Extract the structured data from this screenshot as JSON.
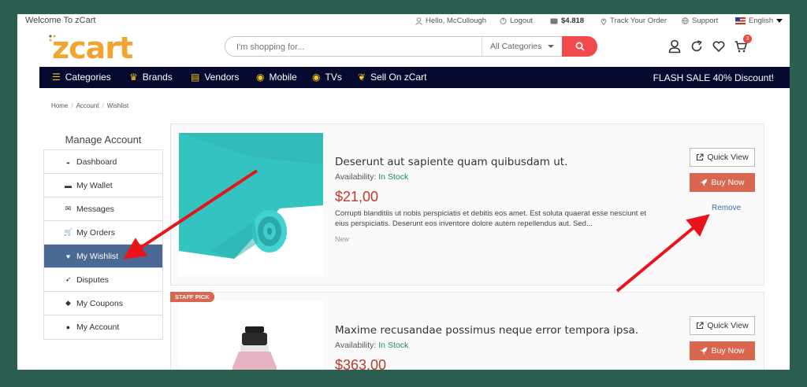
{
  "topbar": {
    "welcome": "Welcome To zCart",
    "greeting": "Hello, McCullough",
    "logout": "Logout",
    "wallet": "$4.818",
    "track": "Track Your Order",
    "support": "Support",
    "language": "English"
  },
  "header": {
    "logo": "zcart",
    "search_placeholder": "I'm shopping for...",
    "category_selected": "All Categories",
    "cart_count": "3"
  },
  "nav": {
    "items": [
      {
        "label": "Categories",
        "icon": "hamburger-icon"
      },
      {
        "label": "Brands",
        "icon": "crown-icon"
      },
      {
        "label": "Vendors",
        "icon": "store-icon"
      },
      {
        "label": "Mobile",
        "icon": "mobile-icon"
      },
      {
        "label": "TVs",
        "icon": "tv-icon"
      },
      {
        "label": "Sell On zCart",
        "icon": "seedling-icon"
      }
    ],
    "flash": "FLASH SALE 40% Discount!"
  },
  "breadcrumb": [
    "Home",
    "Account",
    "Wishlist"
  ],
  "sidebar": {
    "title": "Manage Account",
    "items": [
      {
        "label": "Dashboard",
        "icon": "gauge-icon"
      },
      {
        "label": "My Wallet",
        "icon": "wallet-icon"
      },
      {
        "label": "Messages",
        "icon": "envelope-icon"
      },
      {
        "label": "My Orders",
        "icon": "cart-icon"
      },
      {
        "label": "My Wishlist",
        "icon": "heart-icon"
      },
      {
        "label": "Disputes",
        "icon": "rocket-icon"
      },
      {
        "label": "My Coupons",
        "icon": "tags-icon"
      },
      {
        "label": "My Account",
        "icon": "user-icon"
      }
    ],
    "active": "My Wishlist"
  },
  "products": [
    {
      "title": "Deserunt aut sapiente quam quibusdam ut.",
      "availability_label": "Availability:",
      "availability": "In Stock",
      "price": "$21,00",
      "description": "Corrupti blanditiis ut nobis perspiciatis et debitis eos amet. Est soluta quaerat esse nesciunt et eius perspiciatis. Deserunt eos inventore dolore autem repellendus aut. Sed...",
      "condition": "New",
      "quick_view": "Quick View",
      "buy_now": "Buy Now",
      "remove": "Remove"
    },
    {
      "title": "Maxime recusandae possimus neque error tempora ipsa.",
      "availability_label": "Availability:",
      "availability": "In Stock",
      "price": "$363,00",
      "badge": "STAFF PICK",
      "quick_view": "Quick View",
      "buy_now": "Buy Now"
    }
  ],
  "colors": {
    "background": "#2c5f52",
    "nav": "#060a2e",
    "accent": "#f04a4a",
    "logo": "#f2a42e",
    "active_sidebar": "#4a6a95",
    "buy_button": "#d9664e",
    "price": "#c0392b",
    "in_stock": "#1a8a6a",
    "annotation_arrow": "#e8141a"
  }
}
